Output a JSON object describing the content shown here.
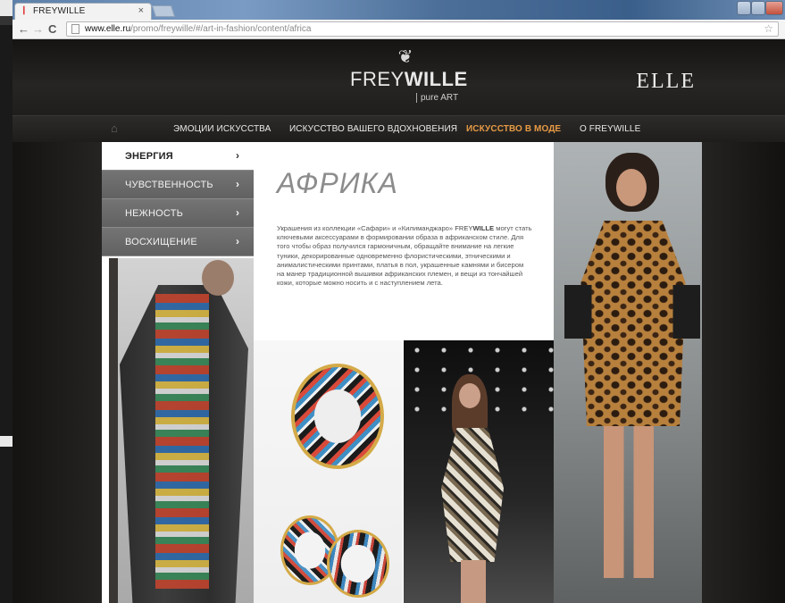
{
  "browser": {
    "tab_title": "FREYWILLE",
    "tab_close": "×",
    "url_host": "www.elle.ru",
    "url_path": "/promo/freywille/#/art-in-fashion/content/africa",
    "back": "←",
    "forward": "→",
    "reload": "C",
    "bookmark": "☆"
  },
  "header": {
    "logo_frey": "FREY",
    "logo_wille": "WILLE",
    "logo_tagline": "pure ART",
    "partner_logo": "ELLE"
  },
  "nav": {
    "items": [
      {
        "label": "ЭМОЦИИ ИСКУССТВА",
        "active": false
      },
      {
        "label": "ИСКУССТВО ВАШЕГО ВДОХНОВЕНИЯ",
        "active": false
      },
      {
        "label": "ИСКУССТВО В МОДЕ",
        "active": true
      },
      {
        "label": "О FREYWILLE",
        "active": false
      }
    ]
  },
  "submenu": {
    "items": [
      {
        "label": "ЭНЕРГИЯ",
        "arrow": "›",
        "active": true
      },
      {
        "label": "ЧУВСТВЕННОСТЬ",
        "arrow": "›",
        "active": false
      },
      {
        "label": "НЕЖНОСТЬ",
        "arrow": "›",
        "active": false
      },
      {
        "label": "ВОСХИЩЕНИЕ",
        "arrow": "›",
        "active": false
      }
    ]
  },
  "article": {
    "heading": "АФРИКА",
    "body_before": "Украшения из коллекции «Сафари» и «Килиманджаро» ",
    "brand_frey": "FREY",
    "brand_wille": "WILLE",
    "body_after": " могут стать ключевыми аксессуарами в формировании образа в африканском стиле. Для того чтобы образ получился гармоничным, обращайте внимание на легкие туники, декорированные одновременно флористическими, этническими и анималистическими принтами, платья в пол, украшенные камнями и бисером на манер традиционной вышивки африканских племен, и вещи из тончайшей кожи, которые можно носить и с наступлением лета."
  },
  "colors": {
    "nav_active": "#e79a45",
    "submenu_inactive": "#6b6b6b",
    "page_bg": "#1b1a19"
  }
}
